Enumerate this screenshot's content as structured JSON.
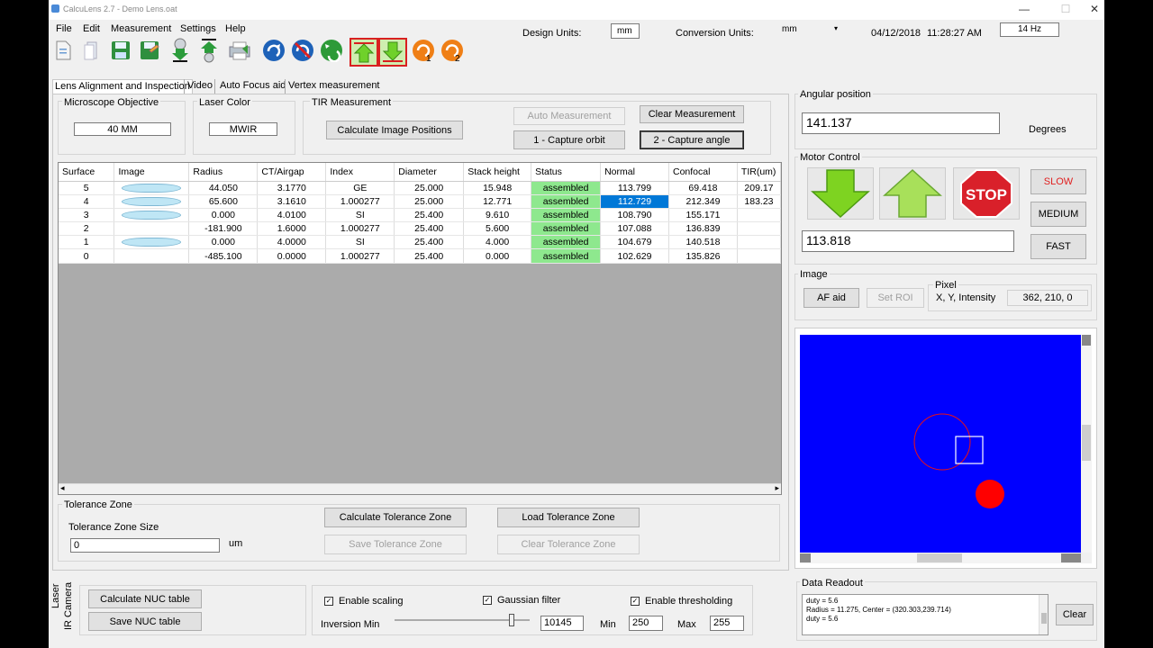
{
  "window": {
    "title": "CalcuLens 2.7 - Demo Lens.oat",
    "minimize": "—",
    "maximize": "☐",
    "close": "✕"
  },
  "menu": [
    "File",
    "Edit",
    "Measurement",
    "Settings",
    "Help"
  ],
  "header": {
    "design_units_label": "Design Units:",
    "design_units_value": "mm",
    "conversion_units_label": "Conversion Units:",
    "conversion_units_value": "mm",
    "date": "04/12/2018",
    "time": "11:28:27 AM",
    "rate": "14 Hz"
  },
  "toolbar_icons": [
    "new-file-icon",
    "open-icon",
    "save-icon",
    "save-as-icon",
    "import-icon",
    "export-icon",
    "print-icon",
    "rotate-cw-icon",
    "stop-rotation-icon",
    "rotate-ccw-icon",
    "motor-up-icon",
    "motor-down-icon",
    "home-1-icon",
    "home-2-icon"
  ],
  "toolbar_badges": {
    "home1": "1",
    "home2": "2"
  },
  "tabs": [
    "Lens Alignment and Inspection",
    "Video",
    "Auto Focus aid",
    "Vertex measurement"
  ],
  "microscope": {
    "label": "Microscope Objective",
    "value": "40 MM"
  },
  "laser": {
    "label": "Laser Color",
    "value": "MWIR"
  },
  "tir": {
    "label": "TIR Measurement",
    "calc_positions": "Calculate Image Positions",
    "auto_measurement": "Auto Measurement",
    "clear_measurement": "Clear Measurement",
    "capture_orbit": "1  -  Capture orbit",
    "capture_angle": "2  -  Capture angle"
  },
  "table": {
    "headers": [
      "Surface",
      "Image",
      "Radius",
      "CT/Airgap",
      "Index",
      "Diameter",
      "Stack height",
      "Status",
      "Normal",
      "Confocal",
      "TIR(um)"
    ],
    "rows": [
      [
        "5",
        "",
        "44.050",
        "3.1770",
        "GE",
        "25.000",
        "15.948",
        "assembled",
        "113.799",
        "69.418",
        "209.17"
      ],
      [
        "4",
        "",
        "65.600",
        "3.1610",
        "1.000277",
        "25.000",
        "12.771",
        "assembled",
        "112.729",
        "212.349",
        "183.23"
      ],
      [
        "3",
        "",
        "0.000",
        "4.0100",
        "SI",
        "25.400",
        "9.610",
        "assembled",
        "108.790",
        "155.171",
        ""
      ],
      [
        "2",
        "",
        "-181.900",
        "1.6000",
        "1.000277",
        "25.400",
        "5.600",
        "assembled",
        "107.088",
        "136.839",
        ""
      ],
      [
        "1",
        "",
        "0.000",
        "4.0000",
        "SI",
        "25.400",
        "4.000",
        "assembled",
        "104.679",
        "140.518",
        ""
      ],
      [
        "0",
        "",
        "-485.100",
        "0.0000",
        "1.000277",
        "25.400",
        "0.000",
        "assembled",
        "102.629",
        "135.826",
        ""
      ]
    ],
    "status_color": "#8ee88e",
    "selected_color": "#0078d7"
  },
  "tolerance": {
    "label": "Tolerance Zone",
    "size_label": "Tolerance Zone Size",
    "size_value": "0",
    "unit": "um",
    "calculate": "Calculate Tolerance Zone",
    "load": "Load Tolerance Zone",
    "save": "Save Tolerance Zone",
    "clear": "Clear Tolerance Zone"
  },
  "bottom": {
    "side_tabs": [
      "Laser",
      "IR Camera"
    ],
    "calc_nuc": "Calculate NUC table",
    "save_nuc": "Save NUC table",
    "enable_scaling": "Enable scaling",
    "gaussian": "Gaussian filter",
    "thresholding": "Enable thresholding",
    "inversion_min": "Inversion Min",
    "inversion_value": "10145",
    "min_label": "Min",
    "min_value": "250",
    "max_label": "Max",
    "max_value": "255",
    "slider_level": 0.88
  },
  "angular": {
    "label": "Angular position",
    "value": "141.137",
    "unit": "Degrees"
  },
  "motor": {
    "label": "Motor Control",
    "stop": "STOP",
    "slow": "SLOW",
    "medium": "MEDIUM",
    "fast": "FAST",
    "value": "113.818"
  },
  "image": {
    "label": "Image",
    "af_aid": "AF aid",
    "set_roi": "Set ROI",
    "pixel_label": "Pixel",
    "xyi_label": "X, Y, Intensity",
    "xyi_value": "362, 210, 0",
    "bg_color": "#0000ff"
  },
  "readout": {
    "label": "Data Readout",
    "lines": [
      "duty = 5.6",
      "Radius = 11.275, Center = (320.303,239.714)",
      "duty = 5.6"
    ],
    "clear": "Clear"
  }
}
